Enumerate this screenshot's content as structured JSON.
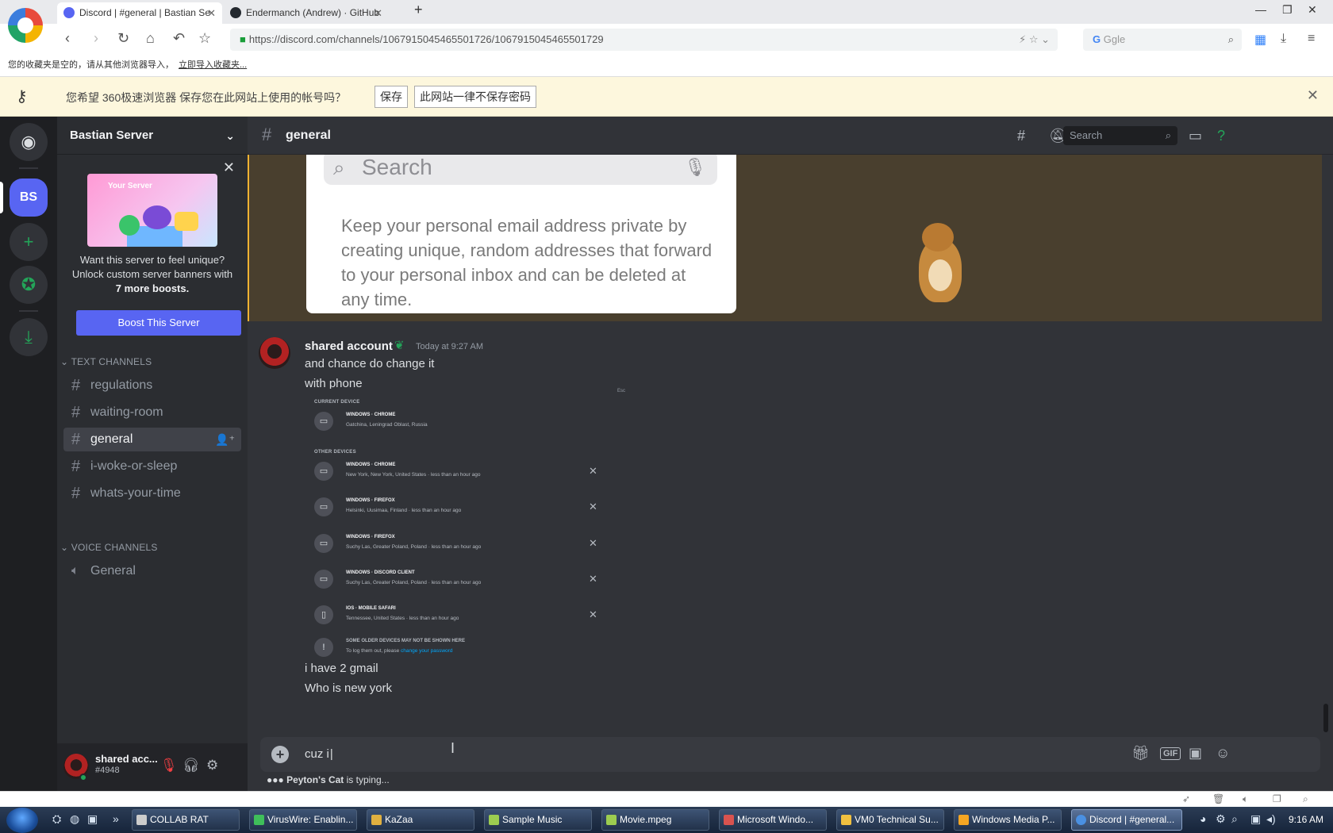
{
  "browser": {
    "tabs": [
      {
        "title": "Discord | #general | Bastian Se",
        "active": true
      },
      {
        "title": "Endermanch (Andrew) · GitHub",
        "active": false
      }
    ],
    "url": "https://discord.com/channels/1067915045465501726/1067915045465501729",
    "search_engine": "Ggle",
    "bookmarks_notice": "您的收藏夹是空的，请从其他浏览器导入，",
    "bookmarks_link": "立即导入收藏夹..."
  },
  "save_prompt": {
    "message": "您希望 360极速浏览器 保存您在此网站上使用的帐号吗？",
    "save": "保存",
    "never": "此网站一律不保存密码"
  },
  "server": {
    "name": "Bastian Server",
    "icon_initials": "BS",
    "boost_banner_label": "Your Server",
    "boost_text_1": "Want this server to feel unique?",
    "boost_text_2": "Unlock custom server banners with",
    "boost_text_bold": "7 more boosts.",
    "boost_button": "Boost This Server",
    "text_category": "TEXT CHANNELS",
    "text_channels": [
      "regulations",
      "waiting-room",
      "general",
      "i-woke-or-sleep",
      "whats-your-time"
    ],
    "voice_category": "VOICE CHANNELS",
    "voice_channels": [
      "General"
    ]
  },
  "user": {
    "name": "shared acc...",
    "tag": "#4948"
  },
  "chat": {
    "channel": "general",
    "search_placeholder": "Search",
    "embed_search": "Search",
    "embed_text": "Keep your personal email address private by creating unique, random addresses that forward to your personal inbox and can be deleted at any time.",
    "message": {
      "author": "shared account",
      "time": "Today at 9:27 AM",
      "lines": [
        "and chance do change it",
        "with phone"
      ],
      "after_lines": [
        "i have 2 gmail",
        "Who is new york"
      ]
    },
    "sessions": {
      "esc": "Esc",
      "current_label": "CURRENT DEVICE",
      "other_label": "OTHER DEVICES",
      "current": {
        "name": "WINDOWS · CHROME",
        "location": "Gatchina, Leningrad Oblast, Russia"
      },
      "others": [
        {
          "name": "WINDOWS · CHROME",
          "location": "New York, New York, United States · less than an hour ago"
        },
        {
          "name": "WINDOWS · FIREFOX",
          "location": "Helsinki, Uusimaa, Finland · less than an hour ago"
        },
        {
          "name": "WINDOWS · FIREFOX",
          "location": "Suchy Las, Greater Poland, Poland · less than an hour ago"
        },
        {
          "name": "WINDOWS · DISCORD CLIENT",
          "location": "Suchy Las, Greater Poland, Poland · less than an hour ago"
        },
        {
          "name": "IOS · MOBILE SAFARI",
          "location": "Tennessee, United States · less than an hour ago"
        }
      ],
      "older_note": "SOME OLDER DEVICES MAY NOT BE SHOWN HERE",
      "older_sub": "To log them out, please",
      "older_link": "change your password"
    },
    "composer_text": "cuz i",
    "typing_user": "Peyton's Cat",
    "typing_suffix": " is typing..."
  },
  "taskbar": {
    "items": [
      "COLLAB RAT",
      "VirusWire: Enablin...",
      "KaZaa",
      "Sample Music",
      "Movie.mpeg",
      "Microsoft Windo...",
      "VM0 Technical Su...",
      "Windows Media P...",
      "Discord | #general..."
    ],
    "clock": "9:16 AM"
  },
  "colors": {
    "blurple": "#5865f2",
    "green": "#23a559",
    "highlight_bg": "#493f2e",
    "highlight_bar": "#f0b232",
    "link": "#00a8fc"
  }
}
